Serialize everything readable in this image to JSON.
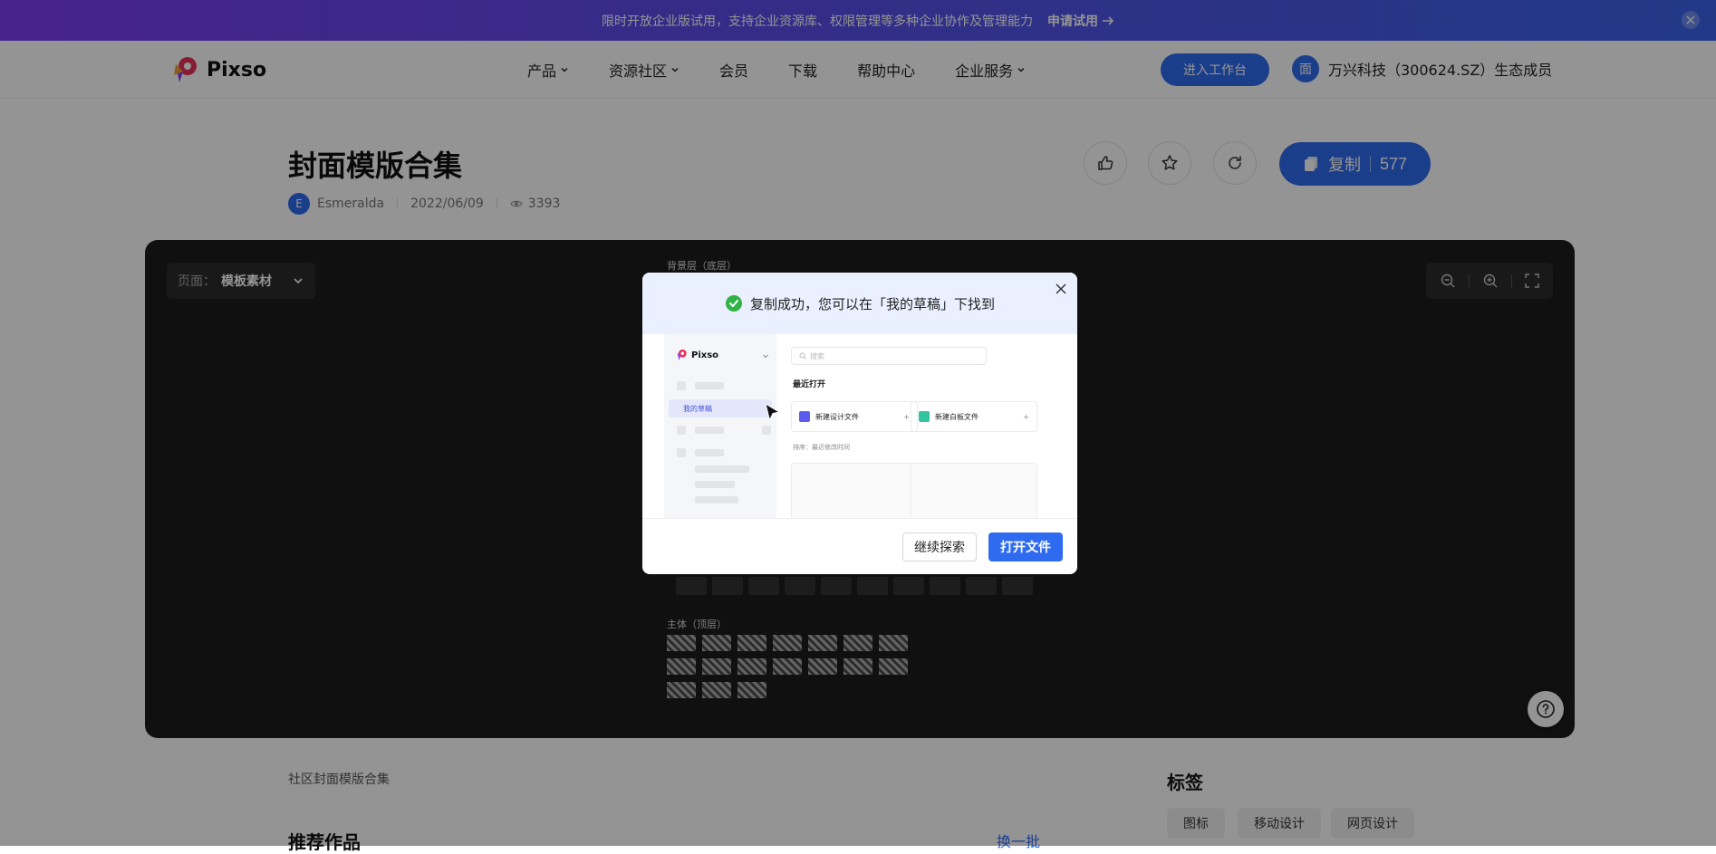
{
  "promo": {
    "text": "限时开放企业版试用，支持企业资源库、权限管理等多种企业协作及管理能力",
    "cta": "申请试用"
  },
  "header": {
    "logo": "Pixso",
    "nav": [
      {
        "label": "产品",
        "dropdown": true
      },
      {
        "label": "资源社区",
        "dropdown": true
      },
      {
        "label": "会员",
        "dropdown": false
      },
      {
        "label": "下载",
        "dropdown": false
      },
      {
        "label": "帮助中心",
        "dropdown": false
      },
      {
        "label": "企业服务",
        "dropdown": true
      }
    ],
    "workspace_button": "进入工作台",
    "eco_badge": "面",
    "eco_text": "万兴科技（300624.SZ）生态成员"
  },
  "work": {
    "title": "封面模版合集",
    "author_initial": "E",
    "author": "Esmeralda",
    "date": "2022/06/09",
    "views": "3393",
    "copy_label": "复制",
    "copy_count": "577"
  },
  "canvas": {
    "page_label": "页面：",
    "page_value": "模板素材",
    "layer_bottom": "背景层（底层）",
    "layer_top": "主体（顶层）"
  },
  "footer": {
    "community": "社区封面模版合集",
    "recommend": "推荐作品",
    "refresh": "换一批",
    "tags_title": "标签",
    "tags": [
      "图标",
      "移动设计",
      "网页设计"
    ]
  },
  "modal": {
    "title": "复制成功，您可以在「我的草稿」下找到",
    "preview": {
      "logo": "Pixso",
      "active_item": "我的草稿",
      "search_placeholder": "搜索",
      "recent": "最近打开",
      "new_design": "新建设计文件",
      "new_whiteboard": "新建白板文件",
      "sort": "排序：最近修改时间"
    },
    "continue_button": "继续探索",
    "open_button": "打开文件"
  },
  "colors": {
    "brand": "#2f6bf0",
    "success": "#2fb344"
  }
}
